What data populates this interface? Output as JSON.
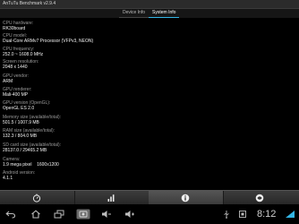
{
  "app": {
    "title": "AnTuTu Benchmark v2.9.4"
  },
  "tabs": [
    {
      "label": "Device Info",
      "active": false
    },
    {
      "label": "System Info",
      "active": true
    }
  ],
  "info": [
    {
      "label": "CPU hardware:",
      "value": "RK30board"
    },
    {
      "label": "CPU model:",
      "value": "Dual-Core ARMv7 Processor (VFPv3, NEON)"
    },
    {
      "label": "CPU frequency:",
      "value": "252.0 ~ 1608.0 MHz"
    },
    {
      "label": "Screen resolution:",
      "value": "2048 x 1440"
    },
    {
      "label": "GPU vendor:",
      "value": "ARM"
    },
    {
      "label": "GPU renderer:",
      "value": "Mali-400 MP"
    },
    {
      "label": "GPU version (OpenGL):",
      "value": "OpenGL ES 2.0"
    },
    {
      "label": "Memory size (available/total):",
      "value": "501.5 / 1007.9 MB"
    },
    {
      "label": "RAM size (available/total):",
      "value": "132.3 / 804.0 MB"
    },
    {
      "label": "SD card size (available/total):",
      "value": "28137.0 / 29465.2 MB"
    },
    {
      "label": "Camera:",
      "value": "1.9 mega pixel    1600x1200"
    },
    {
      "label": "Android version:",
      "value": "4.1.1"
    }
  ],
  "toolbar": {
    "items": [
      {
        "icon": "benchmark-icon"
      },
      {
        "icon": "ranking-icon"
      },
      {
        "icon": "info-icon"
      },
      {
        "icon": "settings-icon"
      }
    ]
  },
  "navbar": {
    "icons": [
      "back-icon",
      "home-icon",
      "recent-apps-icon",
      "screenshot-icon",
      "volume-down-icon",
      "volume-up-icon",
      "usb-icon",
      "notification-icon",
      "signal-icon"
    ],
    "time": "8:12"
  }
}
